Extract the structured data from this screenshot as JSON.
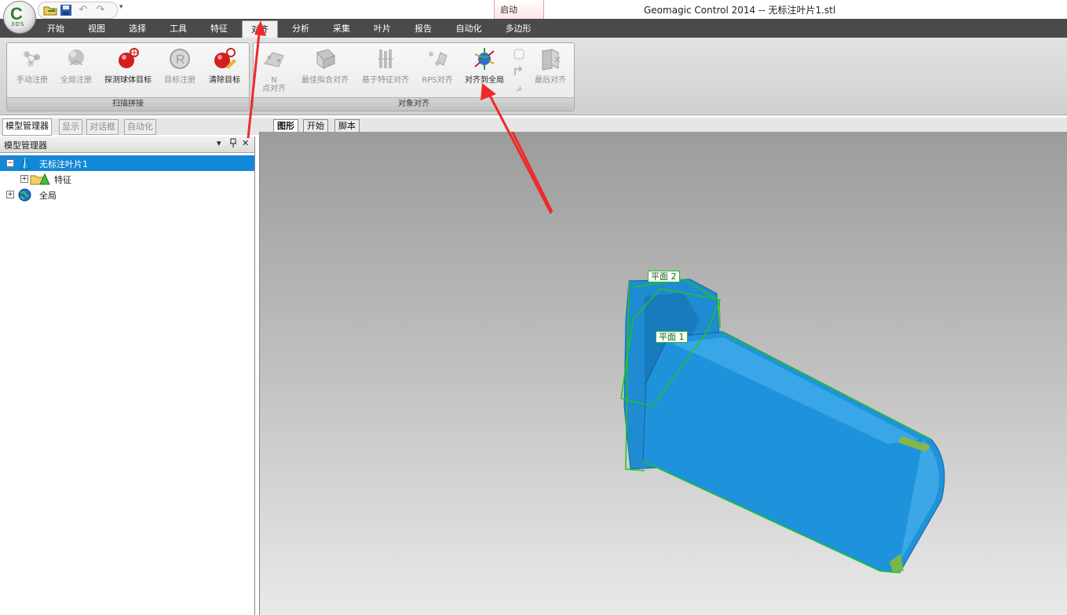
{
  "app": {
    "window_title": "Geomagic Control 2014 -- 无标注叶片1.stl",
    "logo_letter": "C",
    "logo_sub": "3DS",
    "context_tab": "启动"
  },
  "quick_access": {
    "open_icon": "folder-open-icon",
    "save_icon": "save-icon",
    "undo_icon": "undo-icon",
    "redo_icon": "redo-icon",
    "dropdown": "▾"
  },
  "tabs": [
    "开始",
    "视图",
    "选择",
    "工具",
    "特征",
    "对齐",
    "分析",
    "采集",
    "叶片",
    "报告",
    "自动化",
    "多边形"
  ],
  "active_tab": "对齐",
  "ribbon": {
    "scan_group": {
      "label": "扫描拼接",
      "buttons": [
        "手动注册",
        "全局注册",
        "探测球体目标",
        "目标注册",
        "清除目标"
      ]
    },
    "object_group": {
      "label": "对象对齐",
      "buttons": [
        "N\n点对齐",
        "最佳拟合对齐",
        "基于特征对齐",
        "RPS对齐",
        "对齐到全局",
        "最后对齐"
      ]
    }
  },
  "panel_tabs": [
    "模型管理器",
    "显示",
    "对话框",
    "自动化"
  ],
  "panel": {
    "title": "模型管理器",
    "pin_icon": "pin-icon",
    "close_label": "✕",
    "dropdown_label": "▾",
    "tree": [
      {
        "label": "无标注叶片1",
        "expander": "−",
        "selected": true
      },
      {
        "label": "特征",
        "expander": "+",
        "selected": false
      },
      {
        "label": "全局",
        "expander": "+",
        "selected": false
      }
    ]
  },
  "view_tabs": [
    "图形",
    "开始",
    "脚本"
  ],
  "viewport": {
    "plane_labels": [
      "平面 2",
      "平面 1"
    ],
    "model_color": "#1f8fd6",
    "plane_color": "#22c422",
    "annotation_color": "#ee2a2a"
  }
}
